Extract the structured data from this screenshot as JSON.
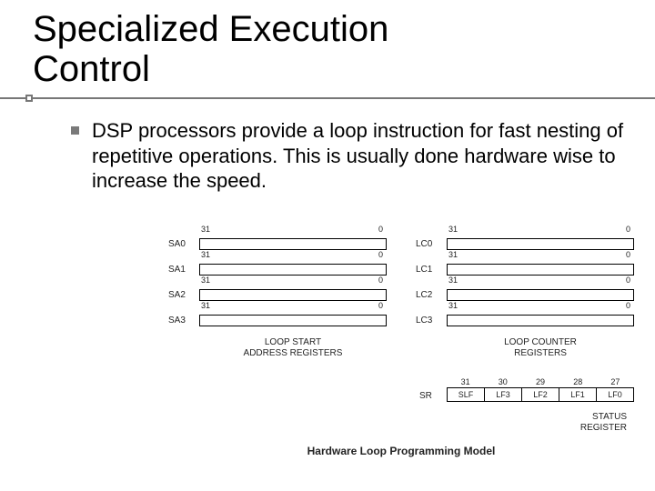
{
  "title_line1": "Specialized Execution",
  "title_line2": "Control",
  "body": "DSP processors provide a loop instruction for fast nesting of repetitive operations. This is usually done hardware wise to increase the speed.",
  "diagram": {
    "bit_hi": "31",
    "bit_lo": "0",
    "start_regs": [
      "SA0",
      "SA1",
      "SA2",
      "SA3"
    ],
    "counter_regs": [
      "LC0",
      "LC1",
      "LC2",
      "LC3"
    ],
    "start_caption_l1": "LOOP START",
    "start_caption_l2": "ADDRESS REGISTERS",
    "counter_caption_l1": "LOOP COUNTER",
    "counter_caption_l2": "REGISTERS",
    "sr_name": "SR",
    "sr_bits": [
      "31",
      "30",
      "29",
      "28",
      "27"
    ],
    "sr_cells": [
      "SLF",
      "LF3",
      "LF2",
      "LF1",
      "LF0"
    ],
    "sr_caption_l1": "STATUS",
    "sr_caption_l2": "REGISTER",
    "figure_caption": "Hardware Loop Programming Model"
  }
}
